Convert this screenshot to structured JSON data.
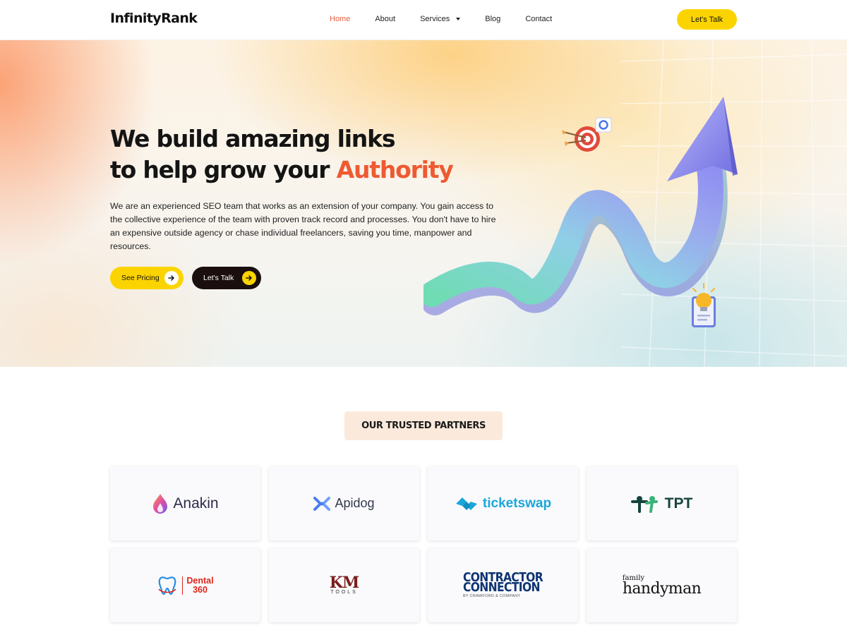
{
  "header": {
    "logo": "InfinityRank",
    "nav": [
      {
        "label": "Home",
        "active": true
      },
      {
        "label": "About",
        "active": false
      },
      {
        "label": "Services",
        "active": false,
        "has_dropdown": true
      },
      {
        "label": "Blog",
        "active": false
      },
      {
        "label": "Contact",
        "active": false
      }
    ],
    "cta_label": "Let's Talk"
  },
  "hero": {
    "title_line1": "We build amazing links",
    "title_line2_prefix": "to help grow your ",
    "title_accent": "Authority",
    "description": "We are an experienced SEO team that works as an extension of your company. You gain access to the collective experience of the team with proven track record and processes. You don't have to hire an expensive outside agency or chase individual freelancers, saving you time, manpower and resources.",
    "primary_button": "See Pricing",
    "secondary_button": "Let's Talk"
  },
  "partners": {
    "badge": "OUR TRUSTED PARTNERS",
    "logos": [
      {
        "name": "Anakin"
      },
      {
        "name": "Apidog"
      },
      {
        "name": "ticketswap"
      },
      {
        "name": "TPT"
      },
      {
        "name_line1": "Dental",
        "name_line2": "360"
      },
      {
        "name": "KM",
        "sub": "TOOLS"
      },
      {
        "name_line1": "CONTRACTOR",
        "name_line2": "CONNECTION",
        "sub": "BY CRAWFORD & COMPANY"
      },
      {
        "name_top": "family",
        "name": "handyman"
      }
    ]
  },
  "colors": {
    "accent_orange": "#ee5a31",
    "nav_active": "#e9603f",
    "cta_yellow": "#fbd400",
    "dark_button": "#1a0e0e",
    "badge_bg": "#fbeadb"
  },
  "icons": [
    "arrow-right-icon",
    "chevron-down-icon",
    "target-icon",
    "lightbulb-clipboard-icon",
    "growth-arrow-illustration"
  ]
}
